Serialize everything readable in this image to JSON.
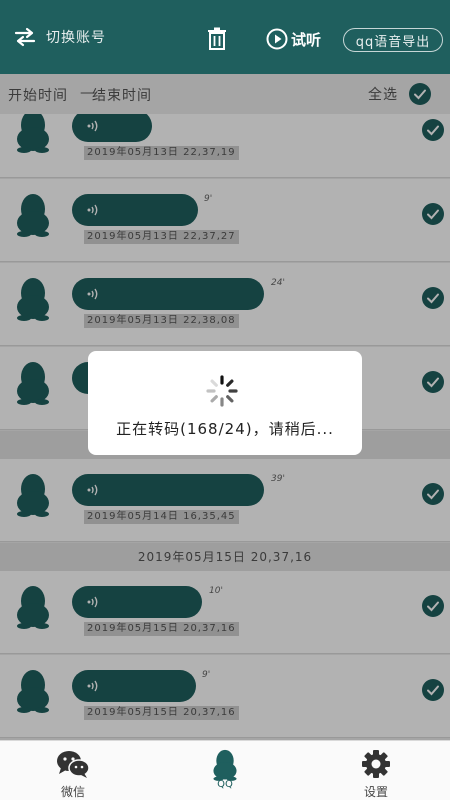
{
  "header": {
    "switch_label": "切换账号",
    "listen_label": "试听",
    "export_label": "qq语音导出"
  },
  "filter": {
    "start_label": "开始时间",
    "dash": "—",
    "end_label": "结束时间",
    "select_all_label": "全选"
  },
  "messages": [
    {
      "duration": "",
      "timestamp": "2019年05月13日  22,37,19",
      "checked": true
    },
    {
      "duration": "9'",
      "timestamp": "2019年05月13日  22,37,27",
      "checked": true
    },
    {
      "duration": "24'",
      "timestamp": "2019年05月13日  22,38,08",
      "checked": true
    },
    {
      "duration": "",
      "timestamp": "",
      "checked": true
    },
    {
      "duration": "39'",
      "timestamp": "2019年05月14日  16,35,45",
      "checked": true
    },
    {
      "duration": "10'",
      "timestamp": "2019年05月15日  20,37,16",
      "checked": true
    },
    {
      "duration": "9'",
      "timestamp": "2019年05月15日  20,37,16",
      "checked": true
    }
  ],
  "date_separator": "2019年05月15日  20,37,16",
  "dialog": {
    "message": "正在转码(168/24)，请稍后..."
  },
  "nav": {
    "wechat_label": "微信",
    "qq_label": "QQ",
    "settings_label": "设置"
  },
  "colors": {
    "primary": "#1f5f5e",
    "header_bg": "#1f5f5e"
  },
  "icons": [
    "swap-icon",
    "trash-icon",
    "play-circle-icon",
    "check-icon",
    "qq-penguin-icon",
    "sound-wave-icon",
    "spinner-icon",
    "wechat-icon",
    "gear-icon"
  ]
}
